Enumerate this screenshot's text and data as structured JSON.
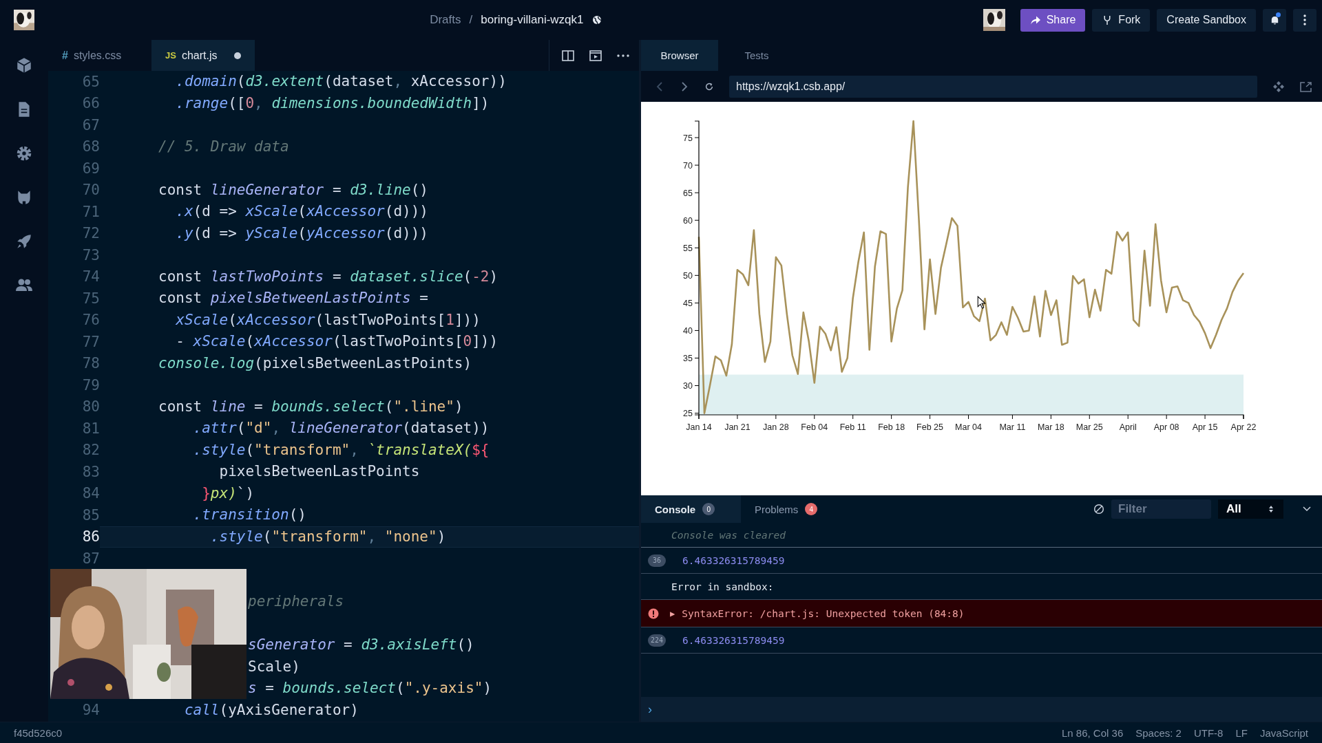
{
  "topbar": {
    "breadcrumb": {
      "folder": "Drafts",
      "separator": "/",
      "sandbox": "boring-villani-wzqk1"
    },
    "buttons": [
      {
        "label": "Share",
        "kind": "share"
      },
      {
        "label": "Fork",
        "kind": "fork"
      },
      {
        "label": "Create Sandbox",
        "kind": "create"
      }
    ],
    "notification_unread": true
  },
  "editor": {
    "tabs": [
      {
        "badge": "#",
        "label": "styles.css",
        "kind": "css",
        "selected": false,
        "modified": false
      },
      {
        "badge": "JS",
        "label": "chart.js",
        "kind": "js",
        "selected": true,
        "modified": true
      }
    ],
    "lines": [
      {
        "number": "65",
        "current": false,
        "tokens": [
          {
            "text": "  .domain",
            "kind": "method"
          },
          {
            "text": "(",
            "kind": "plain"
          },
          {
            "text": "d3.extent",
            "kind": "object"
          },
          {
            "text": "(dataset",
            "kind": "plain"
          },
          {
            "text": ",",
            "kind": "punct"
          },
          {
            "text": " xAccessor))",
            "kind": "plain"
          }
        ]
      },
      {
        "number": "66",
        "current": false,
        "tokens": [
          {
            "text": "  .range",
            "kind": "method"
          },
          {
            "text": "([",
            "kind": "plain"
          },
          {
            "text": "0",
            "kind": "number"
          },
          {
            "text": ",",
            "kind": "punct"
          },
          {
            "text": " dimensions.boundedWidth",
            "kind": "object"
          },
          {
            "text": "])",
            "kind": "plain"
          }
        ]
      },
      {
        "number": "67",
        "current": false
      },
      {
        "number": "68",
        "current": false,
        "tokens": [
          {
            "text": "// 5. Draw data",
            "kind": "comment"
          }
        ]
      },
      {
        "number": "69",
        "current": false
      },
      {
        "number": "70",
        "current": false,
        "tokens": [
          {
            "text": "const",
            "kind": "keyword"
          },
          {
            "text": " lineGenerator",
            "kind": "var"
          },
          {
            "text": " = ",
            "kind": "plain"
          },
          {
            "text": "d3.line",
            "kind": "object"
          },
          {
            "text": "()",
            "kind": "plain"
          }
        ]
      },
      {
        "number": "71",
        "current": false,
        "tokens": [
          {
            "text": "  .x",
            "kind": "method"
          },
          {
            "text": "(d => ",
            "kind": "plain"
          },
          {
            "text": "xScale",
            "kind": "method"
          },
          {
            "text": "(",
            "kind": "plain"
          },
          {
            "text": "xAccessor",
            "kind": "method"
          },
          {
            "text": "(d)))",
            "kind": "plain"
          }
        ]
      },
      {
        "number": "72",
        "current": false,
        "tokens": [
          {
            "text": "  .y",
            "kind": "method"
          },
          {
            "text": "(d => ",
            "kind": "plain"
          },
          {
            "text": "yScale",
            "kind": "method"
          },
          {
            "text": "(",
            "kind": "plain"
          },
          {
            "text": "yAccessor",
            "kind": "method"
          },
          {
            "text": "(d)))",
            "kind": "plain"
          }
        ]
      },
      {
        "number": "73",
        "current": false
      },
      {
        "number": "74",
        "current": false,
        "tokens": [
          {
            "text": "const",
            "kind": "keyword"
          },
          {
            "text": " lastTwoPoints",
            "kind": "var"
          },
          {
            "text": " = ",
            "kind": "plain"
          },
          {
            "text": "dataset.slice",
            "kind": "object"
          },
          {
            "text": "(",
            "kind": "plain"
          },
          {
            "text": "-2",
            "kind": "number"
          },
          {
            "text": ")",
            "kind": "plain"
          }
        ]
      },
      {
        "number": "75",
        "current": false,
        "tokens": [
          {
            "text": "const",
            "kind": "keyword"
          },
          {
            "text": " pixelsBetweenLastPoints",
            "kind": "var"
          },
          {
            "text": " =",
            "kind": "plain"
          }
        ]
      },
      {
        "number": "76",
        "current": false,
        "tokens": [
          {
            "text": "  xScale",
            "kind": "method"
          },
          {
            "text": "(",
            "kind": "plain"
          },
          {
            "text": "xAccessor",
            "kind": "method"
          },
          {
            "text": "(lastTwoPoints[",
            "kind": "plain"
          },
          {
            "text": "1",
            "kind": "number"
          },
          {
            "text": "]))",
            "kind": "plain"
          }
        ]
      },
      {
        "number": "77",
        "current": false,
        "tokens": [
          {
            "text": "  - ",
            "kind": "plain"
          },
          {
            "text": "xScale",
            "kind": "method"
          },
          {
            "text": "(",
            "kind": "plain"
          },
          {
            "text": "xAccessor",
            "kind": "method"
          },
          {
            "text": "(lastTwoPoints[",
            "kind": "plain"
          },
          {
            "text": "0",
            "kind": "number"
          },
          {
            "text": "]))",
            "kind": "plain"
          }
        ]
      },
      {
        "number": "78",
        "current": false,
        "tokens": [
          {
            "text": "console.log",
            "kind": "object"
          },
          {
            "text": "(pixelsBetweenLastPoints)",
            "kind": "plain"
          }
        ]
      },
      {
        "number": "79",
        "current": false
      },
      {
        "number": "80",
        "current": false,
        "tokens": [
          {
            "text": "const",
            "kind": "keyword"
          },
          {
            "text": " line",
            "kind": "var"
          },
          {
            "text": " = ",
            "kind": "plain"
          },
          {
            "text": "bounds.select",
            "kind": "object"
          },
          {
            "text": "(",
            "kind": "plain"
          },
          {
            "text": "\".line\"",
            "kind": "string"
          },
          {
            "text": ")",
            "kind": "plain"
          }
        ]
      },
      {
        "number": "81",
        "current": false,
        "tokens": [
          {
            "text": "    .attr",
            "kind": "method"
          },
          {
            "text": "(",
            "kind": "plain"
          },
          {
            "text": "\"d\"",
            "kind": "string"
          },
          {
            "text": ",",
            "kind": "punct"
          },
          {
            "text": " lineGenerator",
            "kind": "var"
          },
          {
            "text": "(dataset))",
            "kind": "plain"
          }
        ]
      },
      {
        "number": "82",
        "current": false,
        "tokens": [
          {
            "text": "    .style",
            "kind": "method"
          },
          {
            "text": "(",
            "kind": "plain"
          },
          {
            "text": "\"transform\"",
            "kind": "string"
          },
          {
            "text": ",",
            "kind": "punct"
          },
          {
            "text": " `translateX(",
            "kind": "template"
          },
          {
            "text": "${",
            "kind": "brace"
          }
        ]
      },
      {
        "number": "83",
        "current": false,
        "tokens": [
          {
            "text": "       pixelsBetweenLastPoints",
            "kind": "plain"
          }
        ]
      },
      {
        "number": "84",
        "current": false,
        "tokens": [
          {
            "text": "     }",
            "kind": "brace"
          },
          {
            "text": "px)",
            "kind": "template"
          },
          {
            "text": "`)",
            "kind": "plain"
          }
        ]
      },
      {
        "number": "85",
        "current": false,
        "tokens": [
          {
            "text": "    .transition",
            "kind": "method"
          },
          {
            "text": "()",
            "kind": "plain"
          }
        ]
      },
      {
        "number": "86",
        "current": true,
        "tokens": [
          {
            "text": "      .style",
            "kind": "method"
          },
          {
            "text": "(",
            "kind": "plain"
          },
          {
            "text": "\"transform\"",
            "kind": "string"
          },
          {
            "text": ",",
            "kind": "punct"
          },
          {
            "text": " \"none\"",
            "kind": "string"
          },
          {
            "text": ")",
            "kind": "plain"
          }
        ]
      },
      {
        "number": "87",
        "current": false
      },
      {
        "covered": true,
        "current": false
      },
      {
        "covered": true,
        "current": false,
        "tokens": [
          {
            "text": "peripherals",
            "kind": "comment"
          }
        ]
      },
      {
        "covered": true,
        "current": false
      },
      {
        "covered": true,
        "current": false,
        "tokens": [
          {
            "text": "sGenerator",
            "kind": "var"
          },
          {
            "text": " = ",
            "kind": "plain"
          },
          {
            "text": "d3.axisLeft",
            "kind": "object"
          },
          {
            "text": "()",
            "kind": "plain"
          }
        ]
      },
      {
        "covered": true,
        "current": false,
        "tokens": [
          {
            "text": "Scale)",
            "kind": "plain"
          }
        ]
      },
      {
        "covered": true,
        "current": false,
        "tokens": [
          {
            "text": "s",
            "kind": "var"
          },
          {
            "text": " = ",
            "kind": "plain"
          },
          {
            "text": "bounds.select",
            "kind": "object"
          },
          {
            "text": "(",
            "kind": "plain"
          },
          {
            "text": "\".y-axis\"",
            "kind": "string"
          },
          {
            "text": ")",
            "kind": "plain"
          }
        ]
      },
      {
        "number": "94",
        "current": false,
        "tokens": [
          {
            "text": "   call",
            "kind": "method"
          },
          {
            "text": "(yAxisGenerator)",
            "kind": "plain"
          }
        ]
      }
    ]
  },
  "preview": {
    "tabs": [
      {
        "label": "Browser",
        "selected": true
      },
      {
        "label": "Tests",
        "selected": false
      }
    ],
    "url": "https://wzqk1.csb.app/",
    "chart_data": {
      "type": "line",
      "categories": [
        "Jan 14",
        null,
        null,
        null,
        null,
        null,
        null,
        "Jan 21",
        null,
        null,
        null,
        null,
        null,
        null,
        "Jan 28",
        null,
        null,
        null,
        null,
        null,
        null,
        "Feb 04",
        null,
        null,
        null,
        null,
        null,
        null,
        "Feb 11",
        null,
        null,
        null,
        null,
        null,
        null,
        "Feb 18",
        null,
        null,
        null,
        null,
        null,
        null,
        "Feb 25",
        null,
        null,
        null,
        null,
        null,
        null,
        "Mar 04",
        null,
        null,
        null,
        null,
        null,
        null,
        null,
        "Mar 11",
        null,
        null,
        null,
        null,
        null,
        null,
        "Mar 18",
        null,
        null,
        null,
        null,
        null,
        null,
        "Mar 25",
        null,
        null,
        null,
        null,
        null,
        null,
        "April",
        null,
        null,
        null,
        null,
        null,
        null,
        "Apr 08",
        null,
        null,
        null,
        null,
        null,
        null,
        "Apr 15",
        null,
        null,
        null,
        null,
        null,
        null,
        "Apr 22"
      ],
      "ylim": [
        24.7,
        78
      ],
      "yticks": [
        25,
        30,
        35,
        40,
        45,
        50,
        55,
        60,
        65,
        70,
        75
      ],
      "series": [
        {
          "color": "#a8925a",
          "values": [
            57,
            25,
            30,
            35.3,
            34.6,
            31.8,
            37.5,
            51,
            50.2,
            48.2,
            58.2,
            43,
            34.3,
            38,
            53.3,
            51.8,
            43,
            35.5,
            32.1,
            43.3,
            38,
            30.5,
            40.7,
            39.4,
            36.4,
            40.6,
            32.5,
            35,
            45.9,
            52.5,
            57.8,
            36.5,
            51.6,
            58,
            57.5,
            38,
            44,
            47.3,
            66,
            78,
            60,
            40.2,
            52.9,
            43,
            51.4,
            55.8,
            60.4,
            59,
            44.2,
            45.2,
            42.6,
            41.7,
            45.8,
            38.2,
            39.2,
            41.5,
            39.2,
            44.3,
            42.3,
            39.8,
            40,
            46.2,
            38.9,
            47.2,
            42.8,
            45.5,
            37.4,
            37.8,
            49.9,
            48.5,
            49.3,
            42.4,
            47.4,
            43.6,
            51,
            50.3,
            57.9,
            56.3,
            57.8,
            41.9,
            40.8,
            54.5,
            44.5,
            59.3,
            49.1,
            43.3,
            47.8,
            48,
            45.5,
            45,
            42.8,
            41.6,
            39.5,
            36.8,
            39.2,
            41.9,
            44,
            47,
            49,
            50.4
          ]
        }
      ],
      "bands": [
        {
          "axis": "y",
          "from": 24.7,
          "to": 32
        }
      ]
    }
  },
  "console": {
    "tabs": [
      {
        "label": "Console",
        "count": "0",
        "color": "#4b5a72",
        "selected": true
      },
      {
        "label": "Problems",
        "count": "4",
        "color": "#e56b6b",
        "selected": false
      }
    ],
    "filter": {
      "placeholder": "Filter"
    },
    "level": "All",
    "messages": [
      {
        "kind": "info",
        "text": "Console was cleared"
      },
      {
        "kind": "log",
        "count": "36",
        "text": "6.463326315789459"
      },
      {
        "kind": "plain",
        "text": "Error in sandbox:"
      },
      {
        "kind": "error",
        "marker": "▶",
        "text": "SyntaxError: /chart.js: Unexpected token (84:8)"
      },
      {
        "kind": "log",
        "count": "224",
        "text": "6.463326315789459"
      }
    ],
    "prompt": "›"
  },
  "status_bar": {
    "commit": "f45d526c0",
    "items": [
      "Ln 86, Col 36",
      "Spaces: 2",
      "UTF-8",
      "LF",
      "JavaScript"
    ]
  }
}
